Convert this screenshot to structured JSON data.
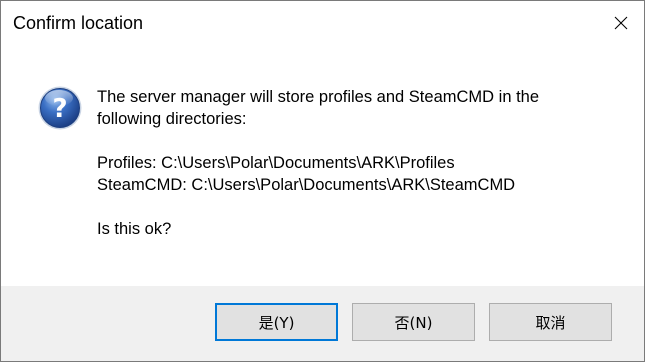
{
  "window": {
    "title": "Confirm location",
    "close_icon": "close-icon"
  },
  "message": {
    "icon": "question-icon",
    "line1": "The server manager will store profiles and SteamCMD in the",
    "line2": "following directories:",
    "profiles": "Profiles: C:\\Users\\Polar\\Documents\\ARK\\Profiles",
    "steamcmd": "SteamCMD: C:\\Users\\Polar\\Documents\\ARK\\SteamCMD",
    "question": "Is this ok?"
  },
  "buttons": {
    "yes": "是(Y)",
    "no": "否(N)",
    "cancel": "取消"
  },
  "colors": {
    "accent": "#0078d7",
    "footer_bg": "#f0f0f0",
    "button_bg": "#e1e1e1"
  }
}
